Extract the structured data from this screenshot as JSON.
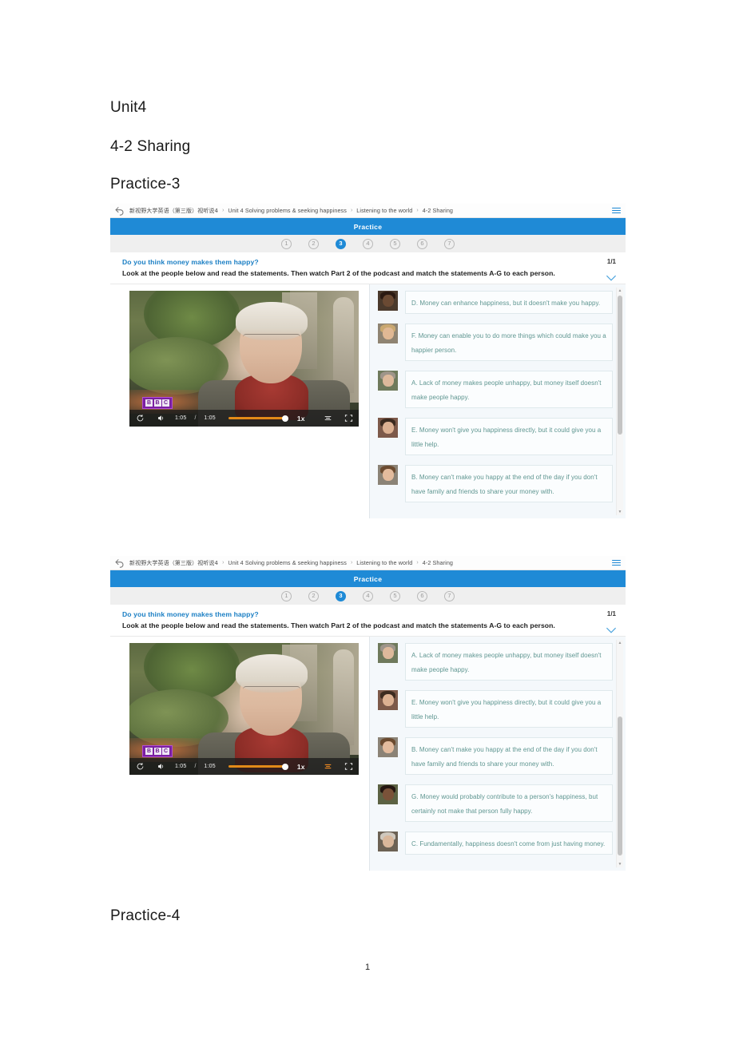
{
  "document": {
    "headings": {
      "unit": "Unit4",
      "sharing": "4-2 Sharing",
      "practice3": "Practice-3",
      "practice4": "Practice-4"
    },
    "page_number": "1"
  },
  "screenshot": {
    "breadcrumb": {
      "back_icon": "back-arrow-icon",
      "menu_icon": "hamburger-menu-icon",
      "separator": "›",
      "items": [
        "新视野大学英语（第三版）视听说4",
        "Unit 4 Solving problems & seeking happiness",
        "Listening to the world",
        "4-2 Sharing"
      ]
    },
    "banner": {
      "title": "Practice"
    },
    "steps": {
      "items": [
        "1",
        "2",
        "3",
        "4",
        "5",
        "6",
        "7"
      ],
      "active_index": 2
    },
    "question": {
      "title": "Do you think money makes them happy?",
      "body": "Look at the people below and read the statements. Then watch Part 2 of the podcast and match the statements A-G to each person.",
      "counter": "1/1",
      "collapse_icon": "chevron-down-icon"
    },
    "player": {
      "replay_icon": "replay-icon",
      "volume_icon": "volume-icon",
      "current_time": "1:05",
      "time_separator": "/",
      "duration": "1:05",
      "playback_rate": "1x",
      "subtitle_icon": "subtitle-cc-icon",
      "fullscreen_icon": "fullscreen-icon",
      "watermark": [
        "B",
        "B",
        "C"
      ],
      "volume_percent": 100
    },
    "statements": {
      "view1": [
        {
          "letter": "D",
          "text": "D. Money can enhance happiness, but it doesn't make you happy.",
          "avatar_skin": "#6b4a33",
          "avatar_hair": "#2b1a12",
          "avatar_bg": "#4b3a2c"
        },
        {
          "letter": "F",
          "text": "F. Money can enable you to do more things which could make you a happier person.",
          "avatar_skin": "#e0b894",
          "avatar_hair": "#c9a870",
          "avatar_bg": "#8f8472"
        },
        {
          "letter": "A",
          "text": "A. Lack of money makes people unhappy, but money itself doesn't make people happy.",
          "avatar_skin": "#ddb99b",
          "avatar_hair": "#9e958a",
          "avatar_bg": "#6f7a5c"
        },
        {
          "letter": "E",
          "text": "E. Money won't give you happiness directly, but it could give you a little help.",
          "avatar_skin": "#dcb192",
          "avatar_hair": "#3c2b20",
          "avatar_bg": "#7d5a4a"
        },
        {
          "letter": "B",
          "text": "B. Money can't make you happy at the end of the day if you don't have family and friends to share your money with.",
          "avatar_skin": "#e3bb9d",
          "avatar_hair": "#6b4b30",
          "avatar_bg": "#8b8376"
        }
      ],
      "view2": [
        {
          "letter": "A",
          "text": "A. Lack of money makes people unhappy, but money itself doesn't make people happy.",
          "avatar_skin": "#ddb99b",
          "avatar_hair": "#9e958a",
          "avatar_bg": "#6f7a5c"
        },
        {
          "letter": "E",
          "text": "E. Money won't give you happiness directly, but it could give you a little help.",
          "avatar_skin": "#dcb192",
          "avatar_hair": "#3c2b20",
          "avatar_bg": "#7d5a4a"
        },
        {
          "letter": "B",
          "text": "B. Money can't make you happy at the end of the day if you don't have family and friends to share your money with.",
          "avatar_skin": "#e3bb9d",
          "avatar_hair": "#6b4b30",
          "avatar_bg": "#8b8376"
        },
        {
          "letter": "G",
          "text": "G. Money would probably contribute to a person's happiness, but certainly not make that person fully happy.",
          "avatar_skin": "#7a5239",
          "avatar_hair": "#241611",
          "avatar_bg": "#5c6243"
        },
        {
          "letter": "C",
          "text": "C. Fundamentally, happiness doesn't come from just having money.",
          "avatar_skin": "#d9b79a",
          "avatar_hair": "#cfc8bd",
          "avatar_bg": "#6c6254"
        }
      ]
    },
    "colors": {
      "brand_blue": "#1f8ad6",
      "question_title_blue": "#1b7fc4",
      "statement_text": "#5f9691",
      "accent_orange": "#e38a18",
      "step_inactive": "#9a9a9a"
    }
  }
}
